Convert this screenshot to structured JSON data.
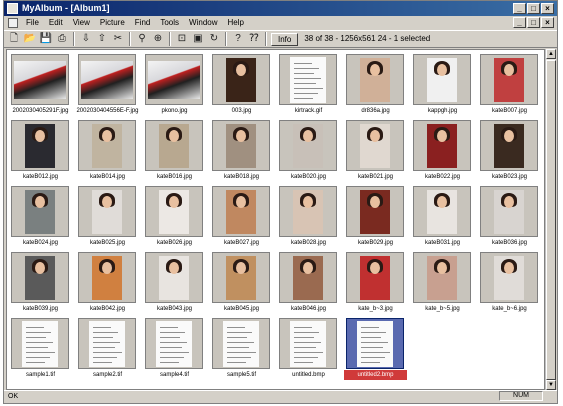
{
  "window": {
    "title": "MyAlbum - [Album1]",
    "minimize": "_",
    "maximize": "□",
    "close": "×"
  },
  "menu": [
    "File",
    "Edit",
    "View",
    "Picture",
    "Find",
    "Tools",
    "Window",
    "Help"
  ],
  "toolbar": {
    "icons": [
      "new-icon",
      "open-icon",
      "save-icon",
      "print-icon",
      "import-icon",
      "export-icon",
      "cut-icon",
      "find-icon",
      "zoom-icon",
      "crop-icon",
      "slideshow-icon",
      "rotate-icon",
      "help-icon",
      "context-help-icon"
    ],
    "info_label": "Info",
    "status": "38 of 38 - 1256x561 24 - 1 selected"
  },
  "thumbnails": [
    {
      "caption": "2002030405291F.jpg",
      "kind": "sport",
      "bg": "#e8e6e8"
    },
    {
      "caption": "2002030404556E-F.jpg",
      "kind": "sport",
      "bg": "#e8e6e8"
    },
    {
      "caption": "pkono.jpg",
      "kind": "sport",
      "bg": "#dcdcdc"
    },
    {
      "caption": "003.jpg",
      "kind": "portrait",
      "bg": "#3a2418"
    },
    {
      "caption": "kirtrack.gif",
      "kind": "doc",
      "bg": "#f4f4f4"
    },
    {
      "caption": "dr836a.jpg",
      "kind": "portrait",
      "bg": "#d0b098"
    },
    {
      "caption": "kappgh.jpg",
      "kind": "portrait",
      "bg": "#f0f0f0"
    },
    {
      "caption": "kateB007.jpg",
      "kind": "portrait",
      "bg": "#c04040"
    },
    {
      "caption": "kateB012.jpg",
      "kind": "portrait",
      "bg": "#2a2a30"
    },
    {
      "caption": "kateB014.jpg",
      "kind": "portrait",
      "bg": "#c0b4a0"
    },
    {
      "caption": "kateB016.jpg",
      "kind": "portrait",
      "bg": "#b8a890"
    },
    {
      "caption": "kateB018.jpg",
      "kind": "portrait",
      "bg": "#a09080"
    },
    {
      "caption": "kateB020.jpg",
      "kind": "portrait",
      "bg": "#c8c0b8"
    },
    {
      "caption": "kateB021.jpg",
      "kind": "portrait",
      "bg": "#e0d8d0"
    },
    {
      "caption": "kateB022.jpg",
      "kind": "portrait",
      "bg": "#8a2020"
    },
    {
      "caption": "kateB023.jpg",
      "kind": "portrait",
      "bg": "#3a2a20"
    },
    {
      "caption": "kateB024.jpg",
      "kind": "portrait",
      "bg": "#7a8080"
    },
    {
      "caption": "kateB025.jpg",
      "kind": "portrait",
      "bg": "#e0dcd8"
    },
    {
      "caption": "kateB026.jpg",
      "kind": "portrait",
      "bg": "#ece8e4"
    },
    {
      "caption": "kateB027.jpg",
      "kind": "portrait",
      "bg": "#c08860"
    },
    {
      "caption": "kateB028.jpg",
      "kind": "portrait",
      "bg": "#d8c4b4"
    },
    {
      "caption": "kateB029.jpg",
      "kind": "portrait",
      "bg": "#7a2a20"
    },
    {
      "caption": "kateB031.jpg",
      "kind": "portrait",
      "bg": "#e8e4e0"
    },
    {
      "caption": "kateB036.jpg",
      "kind": "portrait",
      "bg": "#d8d4d0"
    },
    {
      "caption": "kateB039.jpg",
      "kind": "portrait",
      "bg": "#5a5a5a"
    },
    {
      "caption": "kateB042.jpg",
      "kind": "portrait",
      "bg": "#d08040"
    },
    {
      "caption": "kateB043.jpg",
      "kind": "portrait",
      "bg": "#e8e4e0"
    },
    {
      "caption": "kateB045.jpg",
      "kind": "portrait",
      "bg": "#c09060"
    },
    {
      "caption": "kateB046.jpg",
      "kind": "portrait",
      "bg": "#9a6a50"
    },
    {
      "caption": "kate_b~3.jpg",
      "kind": "portrait",
      "bg": "#c03030"
    },
    {
      "caption": "kate_b~5.jpg",
      "kind": "portrait",
      "bg": "#c8a090"
    },
    {
      "caption": "kate_b~6.jpg",
      "kind": "portrait",
      "bg": "#e0dcd8"
    },
    {
      "caption": "sample1.tif",
      "kind": "doc",
      "bg": "#fafafa"
    },
    {
      "caption": "sample2.tif",
      "kind": "doc",
      "bg": "#fafafa"
    },
    {
      "caption": "sample4.tif",
      "kind": "doc",
      "bg": "#fafafa"
    },
    {
      "caption": "sample5.tif",
      "kind": "doc",
      "bg": "#fafafa"
    },
    {
      "caption": "untitled.bmp",
      "kind": "doc",
      "bg": "#f0f0ec"
    },
    {
      "caption": "untitled2.bmp",
      "kind": "doc",
      "bg": "#f0f0ec",
      "selected": true
    }
  ],
  "statusbar": {
    "left": "OK",
    "num": "NUM"
  }
}
